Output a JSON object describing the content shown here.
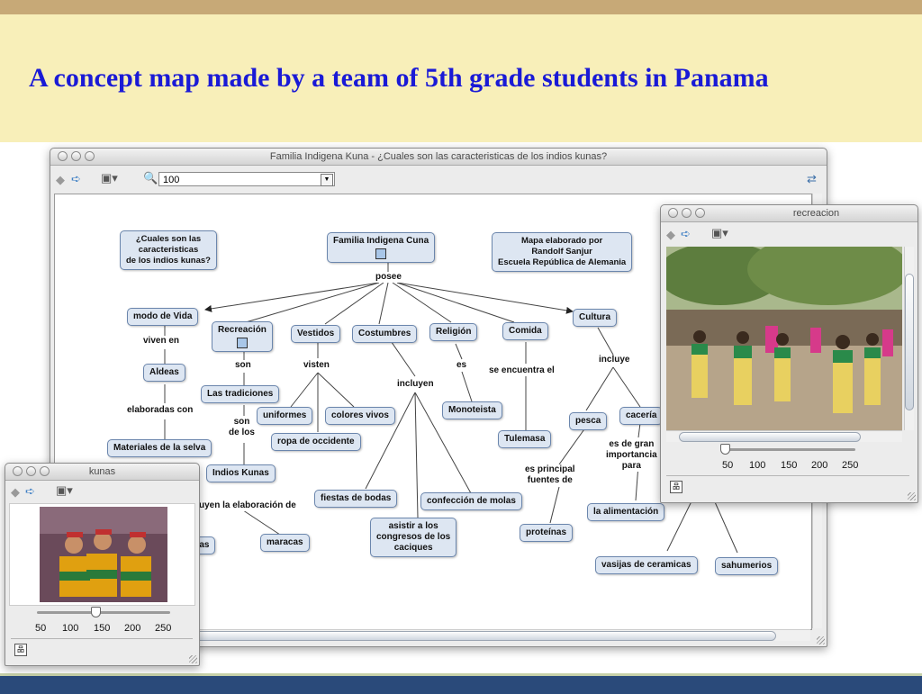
{
  "slide": {
    "title": "A concept map made by a team of 5th grade students in Panama"
  },
  "main_window": {
    "title": "Familia Indigena Kuna - ¿Cuales son las caracteristicas de los indios kunas?",
    "zoom_value": "100"
  },
  "concept_map": {
    "nodes": {
      "question": "¿Cuales son las\ncaracteristicas\nde los indios kunas?",
      "familia": "Familia Indigena Cuna",
      "mapa": "Mapa elaborado por\nRandolf Sanjur\nEscuela República de Alemania",
      "modo_vida": "modo de Vida",
      "recreacion": "Recreación",
      "vestidos": "Vestidos",
      "costumbres": "Costumbres",
      "religion": "Religión",
      "comida": "Comida",
      "cultura": "Cultura",
      "aldeas": "Aldeas",
      "tradiciones": "Las tradiciones",
      "uniformes": "uniformes",
      "colores": "colores vivos",
      "ropa": "ropa de occidente",
      "monoteista": "Monoteista",
      "tulemasa": "Tulemasa",
      "materiales": "Materiales de la selva",
      "indios_kunas": "Indios Kunas",
      "fiestas": "fiestas de bodas",
      "molas": "confección de molas",
      "congresos": "asistir a los\ncongresos de los\ncaciques",
      "pesca": "pesca",
      "caceria": "cacería",
      "alimentacion": "la alimentación",
      "proteinas": "proteínas",
      "maracas": "maracas",
      "tas": "tas",
      "vasijas": "vasijas de ceramicas",
      "sahumerios": "sahumerios"
    },
    "links": {
      "posee": "posee",
      "viven_en": "viven en",
      "son": "son",
      "visten": "visten",
      "es": "es",
      "se_encuentra": "se encuentra el",
      "incluye": "incluye",
      "incluyen": "incluyen",
      "elaboradas": "elaboradas con",
      "son_de_los": "son\nde los",
      "elaboracion": "uyen la elaboración de",
      "principal": "es principal\nfuentes de",
      "importancia": "es de gran\nimportancia\npara"
    }
  },
  "recreacion_window": {
    "title": "recreacion",
    "ticks": [
      "50",
      "100",
      "150",
      "200",
      "250"
    ],
    "slider_value": 20
  },
  "kunas_window": {
    "title": "kunas",
    "ticks": [
      "50",
      "100",
      "150",
      "200",
      "250"
    ],
    "slider_value": 140
  }
}
